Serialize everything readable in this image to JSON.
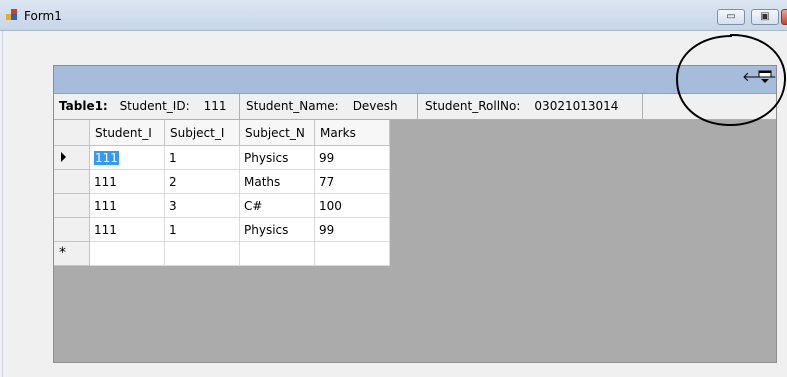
{
  "window": {
    "title": "Form1",
    "minimize_glyph": "▭",
    "maximize_glyph": "▣"
  },
  "grid": {
    "caption_icons": [
      "back-arrow-icon",
      "collapse-caption-icon"
    ],
    "back_glyph": "🡐",
    "parent_row": {
      "table_label": "Table1:",
      "fields": [
        {
          "label": "Student_ID:",
          "value": "111"
        },
        {
          "label": "Student_Name:",
          "value": "Devesh"
        },
        {
          "label": "Student_RollNo:",
          "value": "03021013014"
        }
      ]
    },
    "columns": [
      "Student_I",
      "Subject_I",
      "Subject_N",
      "Marks"
    ],
    "rows": [
      [
        "111",
        "1",
        "Physics",
        "99"
      ],
      [
        "111",
        "2",
        "Maths",
        "77"
      ],
      [
        "111",
        "3",
        "C#",
        "100"
      ],
      [
        "111",
        "1",
        "Physics",
        "99"
      ]
    ],
    "new_row_glyph": "*",
    "selected_cell": {
      "row": 0,
      "col": 0
    }
  },
  "colors": {
    "caption_bg": "#a6bcdb",
    "selection": "#3399ff",
    "grid_background": "#ababab"
  }
}
